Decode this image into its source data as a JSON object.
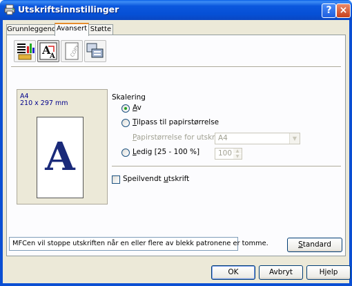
{
  "window": {
    "title": "Utskriftsinnstillinger",
    "help_symbol": "?",
    "close_symbol": "×"
  },
  "tabs": [
    {
      "label": "Grunnleggende",
      "active": false
    },
    {
      "label": "Avansert",
      "active": true
    },
    {
      "label": "Støtte",
      "active": false
    }
  ],
  "toolbar": {
    "buttons": [
      {
        "name": "print-quality-icon",
        "selected": false
      },
      {
        "name": "scaling-icon",
        "selected": true
      },
      {
        "name": "watermark-copy-icon",
        "selected": false
      },
      {
        "name": "device-options-icon",
        "selected": false
      }
    ]
  },
  "preview": {
    "paper": "A4",
    "dimensions": "210 x 297 mm",
    "letter": "A"
  },
  "scaling": {
    "group_label": "Skalering",
    "option_off": {
      "pre": "",
      "u": "A",
      "post": "v"
    },
    "option_fit": {
      "pre": "",
      "u": "T",
      "post": "ilpass til papirstørrelse"
    },
    "paper_size_label": {
      "u": "P",
      "post": "apirstørrelse for utskrift"
    },
    "paper_size_value": "A4",
    "option_free": {
      "pre": "",
      "u": "L",
      "post": "edig [25 - 100 %]"
    },
    "free_value": "100",
    "selected": "off"
  },
  "mirror": {
    "pre": "Speilvendt ",
    "u": "u",
    "post": "tskrift",
    "checked": false
  },
  "status_text": "MFCen vil stoppe utskriften når en eller flere av blekk patronene er tomme.",
  "buttons": {
    "standard": {
      "pre": "",
      "u": "S",
      "post": "tandard"
    },
    "ok": "OK",
    "cancel": "Avbryt",
    "help": "Hjelp"
  },
  "colors": {
    "title_bar": "#0b57de",
    "dialog_bg": "#ece9d8",
    "accent_tab": "#e68b2c",
    "radio_dot": "#21a121"
  }
}
